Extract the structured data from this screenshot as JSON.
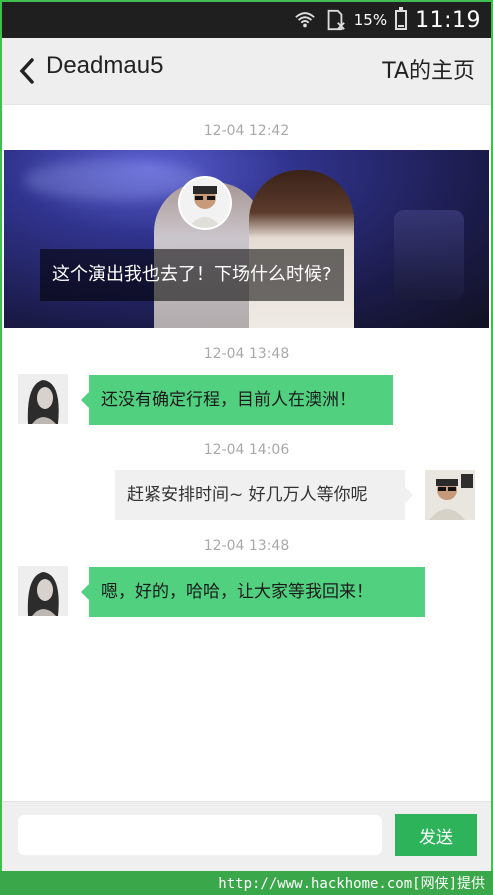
{
  "status_bar": {
    "battery_percent": "15%",
    "battery_level": 0.15,
    "time": "11:19",
    "icons": [
      "wifi-icon",
      "sim-icon",
      "battery-icon"
    ]
  },
  "title_bar": {
    "back_icon": "chevron-left-icon",
    "title": "Deadmau5",
    "home_link": "TA的主页"
  },
  "conversation": {
    "post": {
      "timestamp": "12-04 12:42",
      "caption": "这个演出我也去了！下场什么时候?"
    },
    "messages": [
      {
        "timestamp": "12-04 13:48",
        "direction": "in",
        "text": "还没有确定行程，目前人在澳洲！"
      },
      {
        "timestamp": "12-04 14:06",
        "direction": "out",
        "text": "赶紧安排时间~ 好几万人等你呢"
      },
      {
        "timestamp": "12-04 13:48",
        "direction": "in",
        "text": "嗯，好的，哈哈，让大家等我回来！"
      }
    ]
  },
  "composer": {
    "input_value": "",
    "input_placeholder": "",
    "send_label": "发送"
  },
  "footer": {
    "watermark": "http://www.hackhome.com[网侠]提供"
  },
  "colors": {
    "accent_green": "#2db35a",
    "incoming_bubble": "#51d080",
    "outgoing_bubble": "#f0f0f0",
    "status_bar": "#1f1f1f",
    "frame": "#3fbf4f"
  }
}
